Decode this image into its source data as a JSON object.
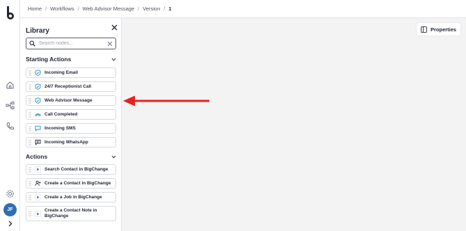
{
  "breadcrumb": {
    "items": [
      "Home",
      "Workflows",
      "Web Advisor Message",
      "Version"
    ],
    "current": "1",
    "separator": "/"
  },
  "rail": {
    "avatar_initials": "JF"
  },
  "library": {
    "title": "Library",
    "search": {
      "placeholder": "Search nodes...",
      "value": ""
    },
    "sections": [
      {
        "title": "Starting Actions",
        "nodes": [
          {
            "label": "Incoming Email",
            "icon": "shield-check-icon"
          },
          {
            "label": "24/7 Receptionist Call",
            "icon": "shield-check-icon"
          },
          {
            "label": "Web Advisor Message",
            "icon": "shield-check-icon"
          },
          {
            "label": "Call Completed",
            "icon": "phone-hangup-icon"
          },
          {
            "label": "Incoming SMS",
            "icon": "chat-bubble-icon"
          },
          {
            "label": "Incoming WhatsApp",
            "icon": "message-square-icon"
          }
        ]
      },
      {
        "title": "Actions",
        "nodes": [
          {
            "label": "Search Contact in BigChange",
            "icon": "play-icon"
          },
          {
            "label": "Create a Contact in BigChange",
            "icon": "user-plus-icon"
          },
          {
            "label": "Create a Job in BigChange",
            "icon": "play-icon"
          },
          {
            "label": "Create a Contact Note in BigChange",
            "icon": "play-icon"
          }
        ]
      }
    ]
  },
  "properties_button": {
    "label": "Properties"
  },
  "colors": {
    "brand": "#1f2430",
    "accent_teal": "#2a8fa8",
    "avatar": "#2f6fb0",
    "annotation_arrow": "#e8201d"
  }
}
